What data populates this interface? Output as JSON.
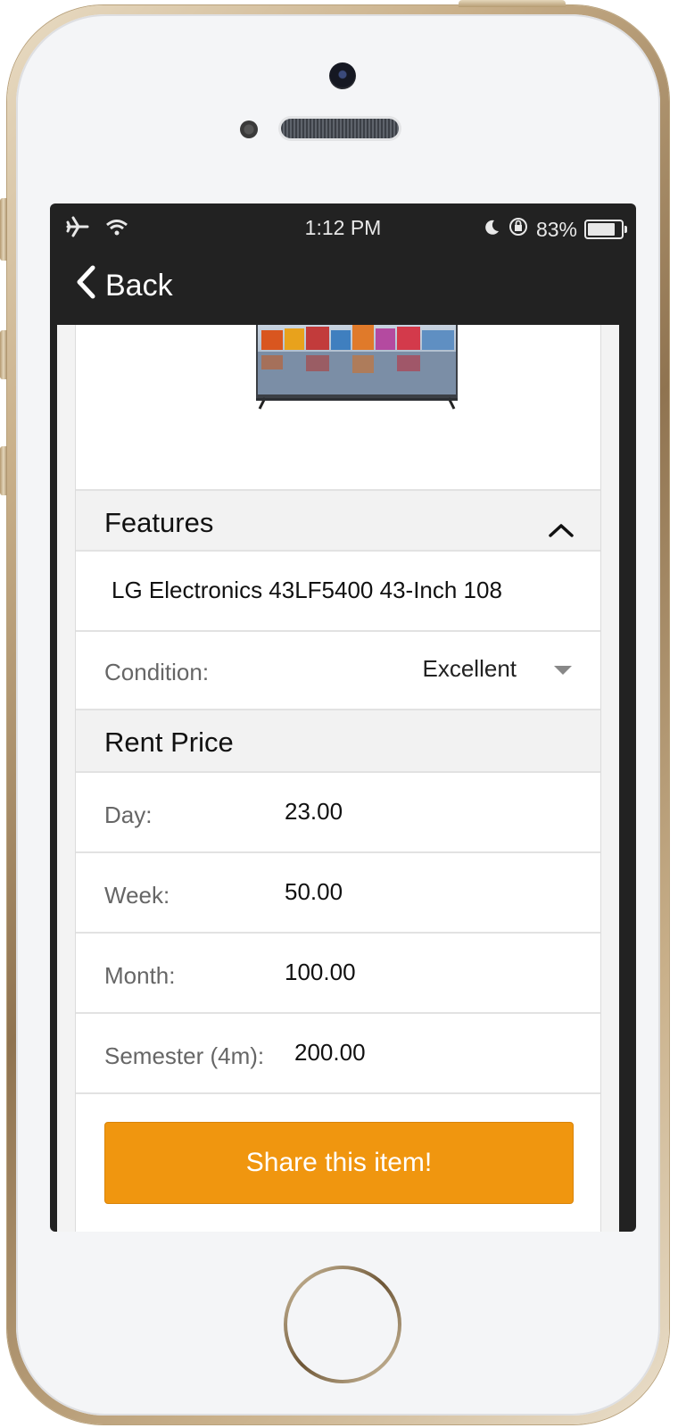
{
  "status_bar": {
    "time": "1:12 PM",
    "battery_percent": "83%",
    "battery_level": 0.83,
    "icons": [
      "airplane-icon",
      "wifi-icon",
      "moon-icon",
      "rotation-lock-icon",
      "battery-icon"
    ]
  },
  "navbar": {
    "back_label": "Back"
  },
  "features": {
    "title": "Features",
    "description": "LG Electronics 43LF5400 43-Inch 108",
    "condition_label": "Condition:",
    "condition_value": "Excellent"
  },
  "rent_price": {
    "title": "Rent Price",
    "rows": [
      {
        "label": "Day:",
        "value": "23.00"
      },
      {
        "label": "Week:",
        "value": "50.00"
      },
      {
        "label": "Month:",
        "value": "100.00"
      },
      {
        "label": "Semester (4m):",
        "value": "200.00"
      }
    ]
  },
  "share_button": "Share this item!",
  "colors": {
    "accent": "#f0960f",
    "navbar": "#222222"
  }
}
